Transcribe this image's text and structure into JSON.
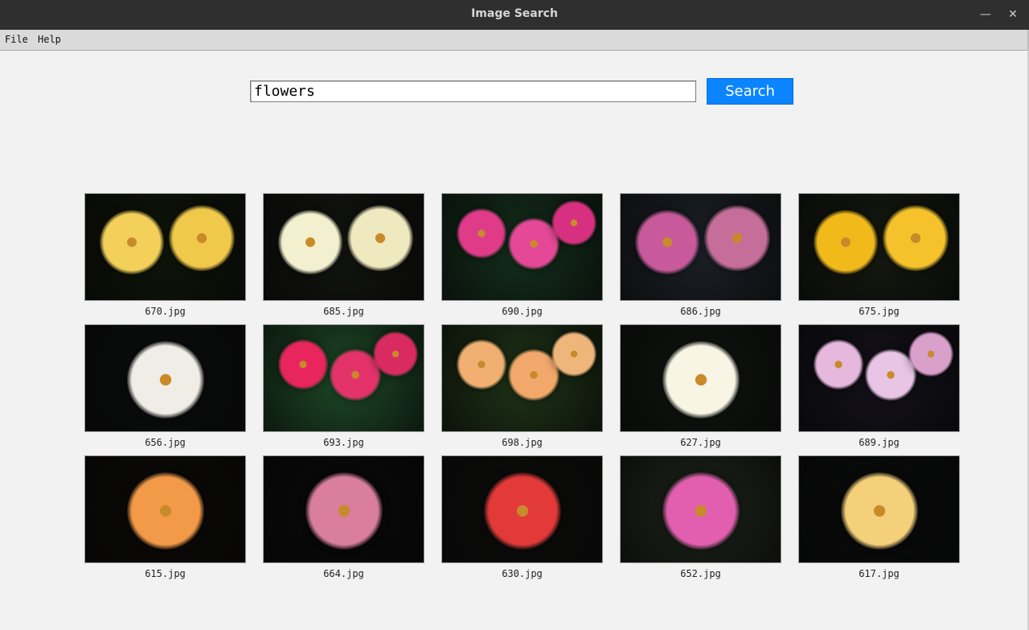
{
  "window": {
    "title": "Image Search",
    "minimize": "—",
    "close": "✕"
  },
  "menu": {
    "items": [
      "File",
      "Help"
    ]
  },
  "search": {
    "query": "flowers",
    "button_label": "Search"
  },
  "colors": {
    "accent": "#0a84ff",
    "title_bar": "#2f2f2f",
    "menu_bar": "#dadada",
    "background": "#f2f2f2"
  },
  "results": [
    {
      "file": "670.jpg",
      "bg": "#0f1609",
      "flowers": [
        "#f2d05a",
        "#f0c84a"
      ]
    },
    {
      "file": "685.jpg",
      "bg": "#131510",
      "flowers": [
        "#f3f0d0",
        "#efe9bf"
      ]
    },
    {
      "file": "690.jpg",
      "bg": "#14301c",
      "flowers": [
        "#e03b88",
        "#e54896",
        "#d83080"
      ]
    },
    {
      "file": "686.jpg",
      "bg": "#1d2228",
      "flowers": [
        "#c85a9b",
        "#c66e9a"
      ]
    },
    {
      "file": "675.jpg",
      "bg": "#151a10",
      "flowers": [
        "#f2b91b",
        "#f5c22b"
      ]
    },
    {
      "file": "656.jpg",
      "bg": "#0c0d0d",
      "flowers": [
        "#f0ede6"
      ]
    },
    {
      "file": "693.jpg",
      "bg": "#1e4a27",
      "flowers": [
        "#e8255d",
        "#e3336a",
        "#d92b61"
      ]
    },
    {
      "file": "698.jpg",
      "bg": "#1f3417",
      "flowers": [
        "#f1b072",
        "#f2a86a",
        "#efb67c"
      ]
    },
    {
      "file": "627.jpg",
      "bg": "#111511",
      "flowers": [
        "#f8f5e5"
      ]
    },
    {
      "file": "689.jpg",
      "bg": "#14121a",
      "flowers": [
        "#e6b8dd",
        "#e8c5e4",
        "#d9a0cc"
      ]
    },
    {
      "file": "615.jpg",
      "bg": "#0b0a08",
      "flowers": [
        "#f39a48"
      ]
    },
    {
      "file": "664.jpg",
      "bg": "#090909",
      "flowers": [
        "#d97e9c"
      ]
    },
    {
      "file": "630.jpg",
      "bg": "#0c0d0b",
      "flowers": [
        "#e23939"
      ]
    },
    {
      "file": "652.jpg",
      "bg": "#1e241b",
      "flowers": [
        "#e25fb0"
      ]
    },
    {
      "file": "617.jpg",
      "bg": "#0a0b0b",
      "flowers": [
        "#f4d07a"
      ]
    }
  ]
}
